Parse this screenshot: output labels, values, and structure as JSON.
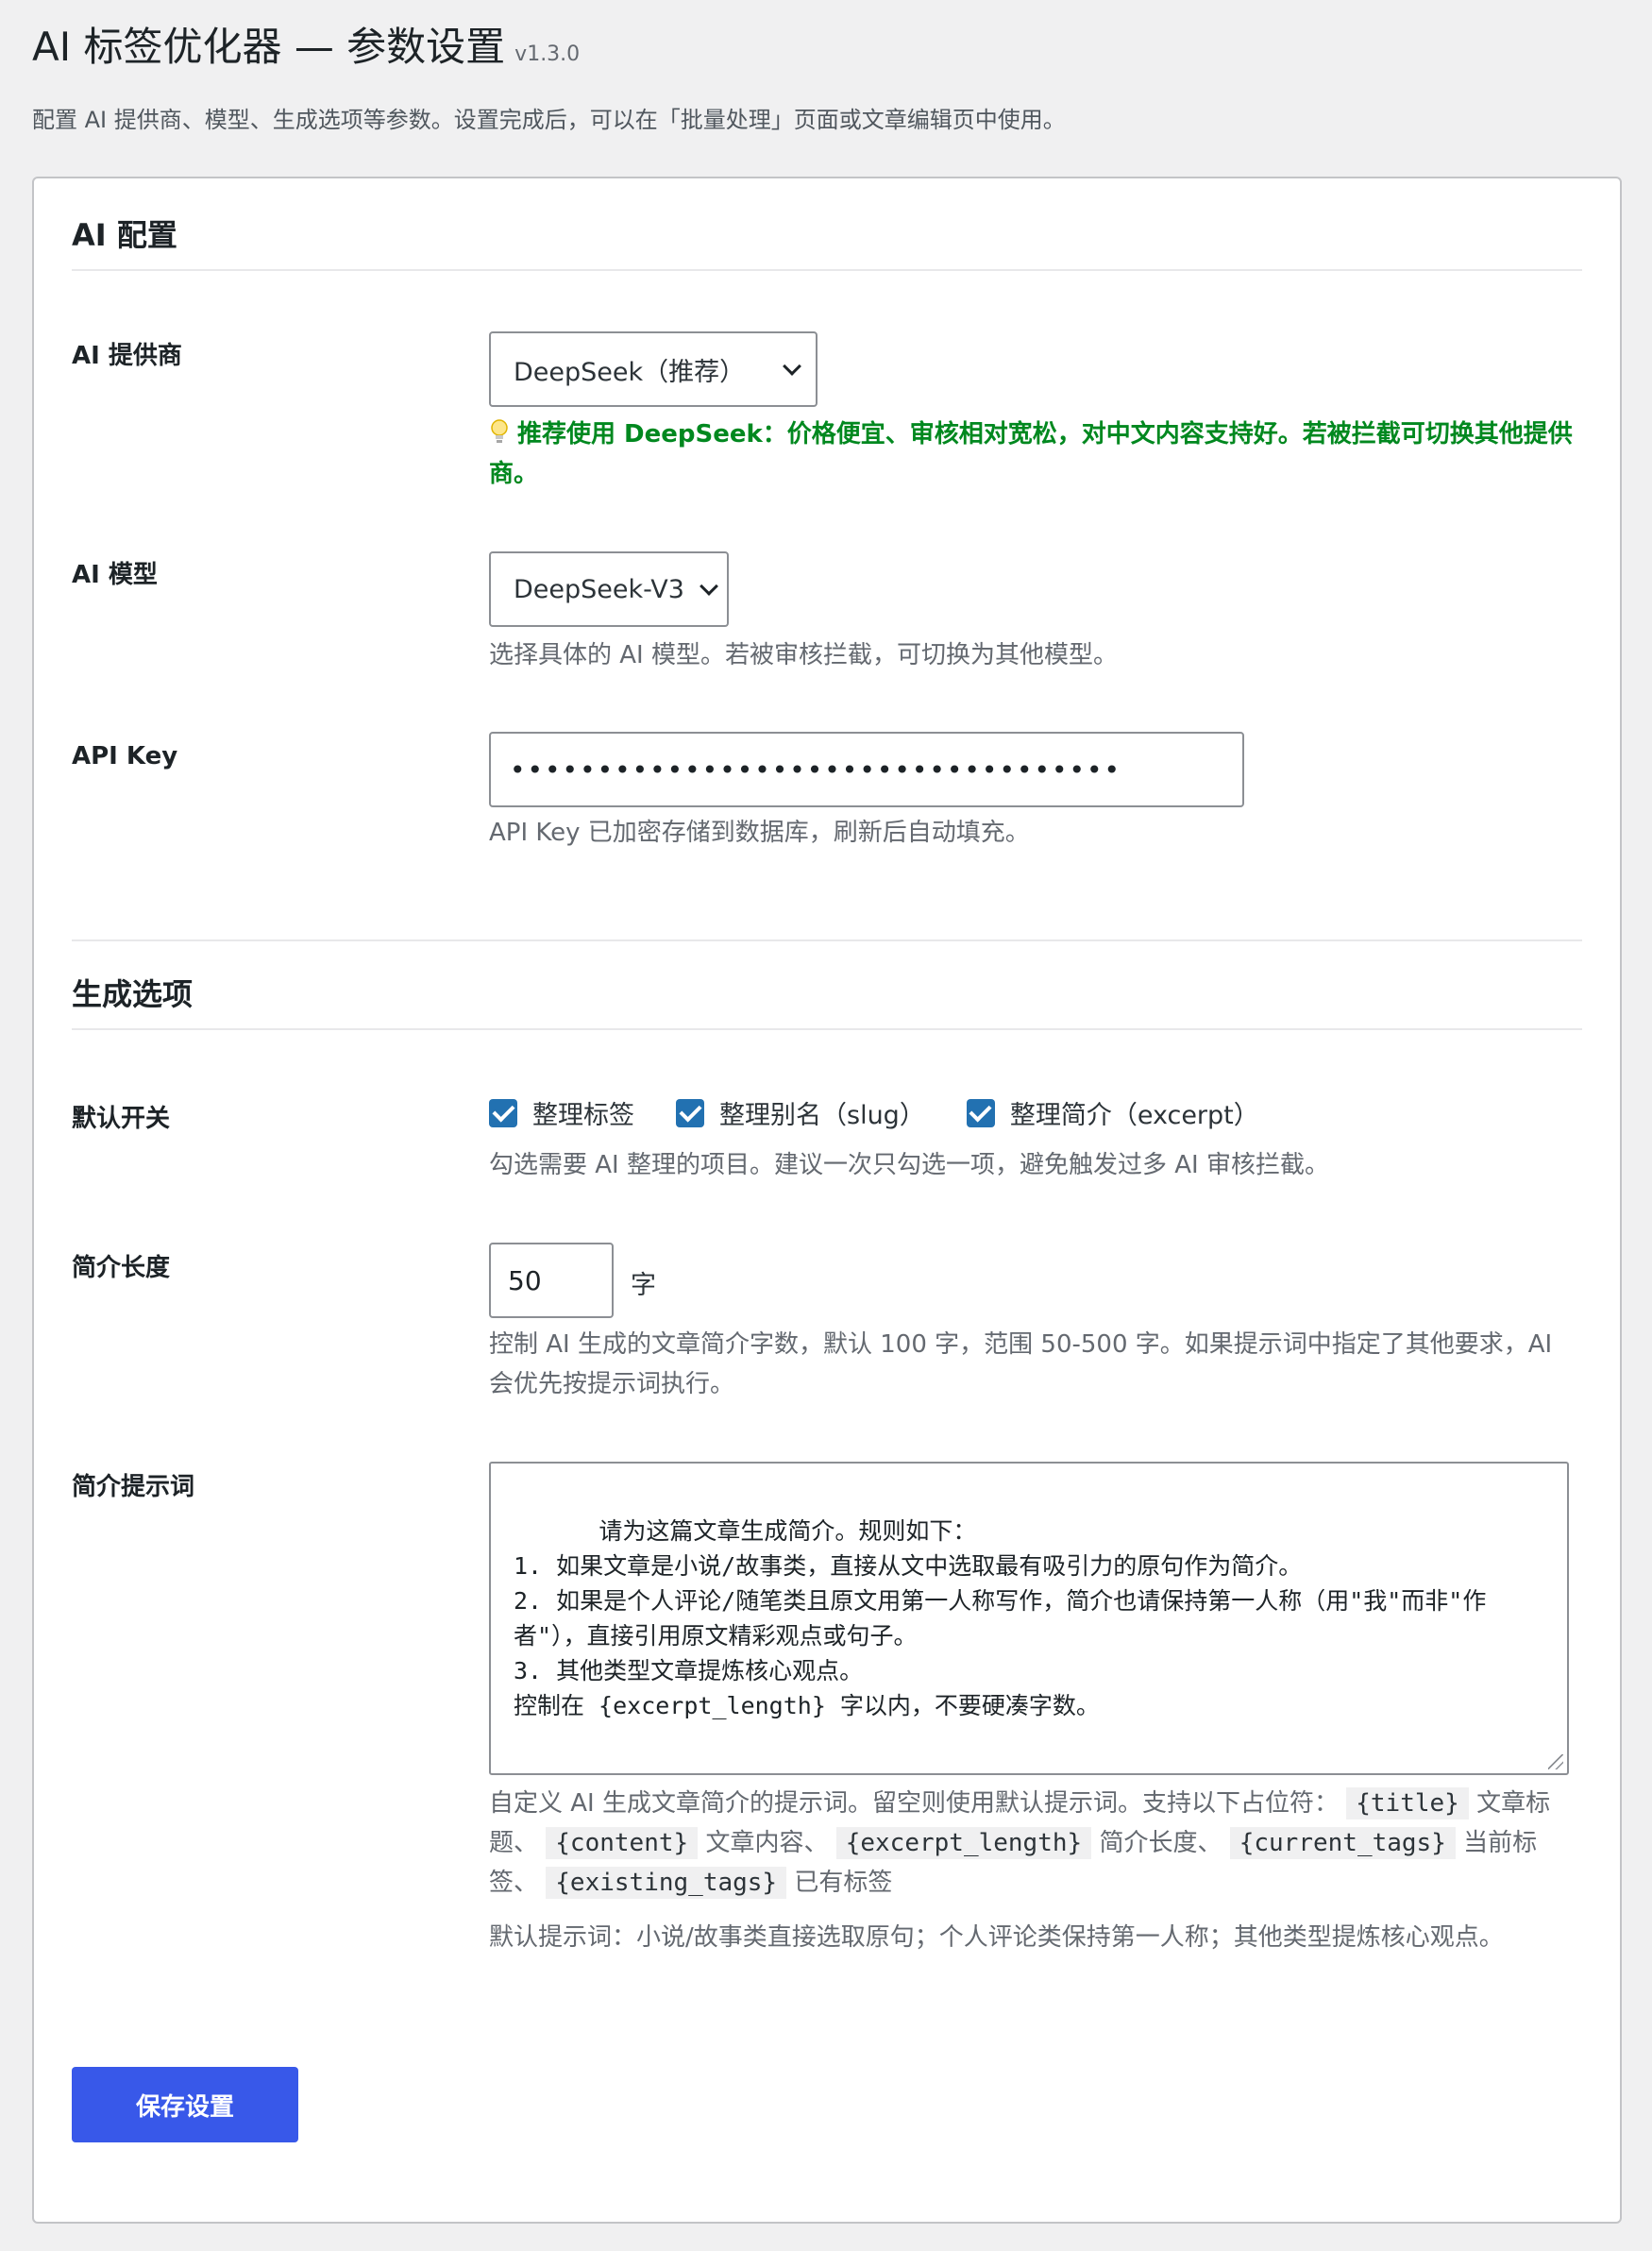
{
  "header": {
    "title": "AI 标签优化器 — 参数设置",
    "version": "v1.3.0",
    "description": "配置 AI 提供商、模型、生成选项等参数。设置完成后，可以在「批量处理」页面或文章编辑页中使用。"
  },
  "ai_config": {
    "section_title": "AI 配置",
    "provider": {
      "label": "AI 提供商",
      "selected": "DeepSeek（推荐）",
      "tip": "推荐使用 DeepSeek：价格便宜、审核相对宽松，对中文内容支持好。若被拦截可切换其他提供商。"
    },
    "model": {
      "label": "AI 模型",
      "selected": "DeepSeek-V3",
      "help": "选择具体的 AI 模型。若被审核拦截，可切换为其他模型。"
    },
    "api_key": {
      "label": "API Key",
      "value_masked": "•••••••••••••••••••••••••••••••••••",
      "help": "API Key 已加密存储到数据库，刷新后自动填充。"
    }
  },
  "generate_options": {
    "section_title": "生成选项",
    "defaults": {
      "label": "默认开关",
      "checkboxes": [
        {
          "label": "整理标签",
          "checked": true
        },
        {
          "label": "整理别名（slug）",
          "checked": true
        },
        {
          "label": "整理简介（excerpt）",
          "checked": true
        }
      ],
      "help": "勾选需要 AI 整理的项目。建议一次只勾选一项，避免触发过多 AI 审核拦截。"
    },
    "excerpt_length": {
      "label": "简介长度",
      "value": "50",
      "unit": "字",
      "help": "控制 AI 生成的文章简介字数，默认 100 字，范围 50-500 字。如果提示词中指定了其他要求，AI 会优先按提示词执行。"
    },
    "excerpt_prompt": {
      "label": "简介提示词",
      "value": "请为这篇文章生成简介。规则如下：\n1. 如果文章是小说/故事类，直接从文中选取最有吸引力的原句作为简介。\n2. 如果是个人评论/随笔类且原文用第一人称写作，简介也请保持第一人称（用\"我\"而非\"作者\"），直接引用原文精彩观点或句子。\n3. 其他类型文章提炼核心观点。\n控制在 {excerpt_length} 字以内，不要硬凑字数。",
      "help_intro": "自定义 AI 生成文章简介的提示词。留空则使用默认提示词。支持以下占位符：",
      "placeholders": [
        {
          "code": "{title}",
          "desc": "文章标题、"
        },
        {
          "code": "{content}",
          "desc": "文章内容、"
        },
        {
          "code": "{excerpt_length}",
          "desc": "简介长度、"
        },
        {
          "code": "{current_tags}",
          "desc": "当前标签、"
        },
        {
          "code": "{existing_tags}",
          "desc": "已有标签"
        }
      ],
      "default_note": "默认提示词：小说/故事类直接选取原句；个人评论类保持第一人称；其他类型提炼核心观点。"
    }
  },
  "save_button": "保存设置"
}
